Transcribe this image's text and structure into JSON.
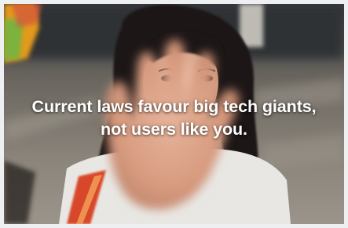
{
  "headline": {
    "line1": "Current laws favour big tech giants,",
    "line2": "not users like you."
  },
  "photo": {
    "subject": "person-raising-hand"
  },
  "colors": {
    "caption": "#ffffff",
    "border": "#eeeff1"
  }
}
